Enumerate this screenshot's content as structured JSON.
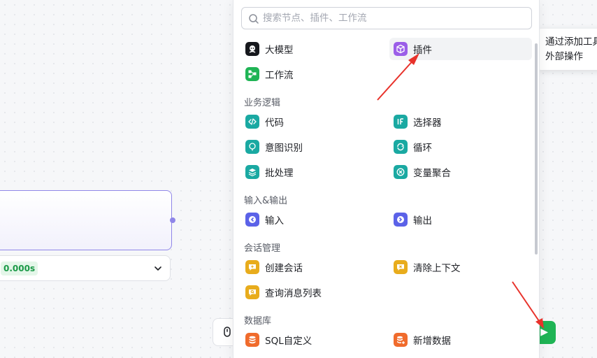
{
  "canvas": {
    "run_time": "0.000s"
  },
  "search": {
    "placeholder": "搜索节点、插件、工作流"
  },
  "tooltip": {
    "line1": "通过添加工具",
    "line2": "外部操作"
  },
  "colors": {
    "black": "#16181d",
    "green": "#1fb455",
    "purple": "#9b5ee8",
    "teal": "#1aa9a2",
    "indigo": "#5b62e8",
    "amber": "#e8ac1c",
    "orange": "#f06b2c",
    "arrow": "#e8322b"
  },
  "panel": {
    "top_items": [
      {
        "label": "大模型",
        "icon": "llm-icon"
      },
      {
        "label": "插件",
        "icon": "plugin-cube-icon"
      },
      {
        "label": "工作流",
        "icon": "workflow-icon"
      }
    ],
    "sections": [
      {
        "title": "业务逻辑",
        "items": [
          {
            "label": "代码",
            "icon": "code-icon"
          },
          {
            "label": "选择器",
            "icon": "if-icon"
          },
          {
            "label": "意图识别",
            "icon": "intent-icon"
          },
          {
            "label": "循环",
            "icon": "loop-icon"
          },
          {
            "label": "批处理",
            "icon": "batch-icon"
          },
          {
            "label": "变量聚合",
            "icon": "variable-merge-icon"
          }
        ]
      },
      {
        "title": "输入&输出",
        "items": [
          {
            "label": "输入",
            "icon": "input-icon"
          },
          {
            "label": "输出",
            "icon": "output-icon"
          }
        ]
      },
      {
        "title": "会话管理",
        "items": [
          {
            "label": "创建会话",
            "icon": "create-conversation-icon"
          },
          {
            "label": "清除上下文",
            "icon": "clear-context-icon"
          },
          {
            "label": "查询消息列表",
            "icon": "query-messages-icon"
          }
        ]
      },
      {
        "title": "数据库",
        "items": [
          {
            "label": "SQL自定义",
            "icon": "sql-icon"
          },
          {
            "label": "新增数据",
            "icon": "add-data-icon"
          }
        ]
      }
    ]
  }
}
